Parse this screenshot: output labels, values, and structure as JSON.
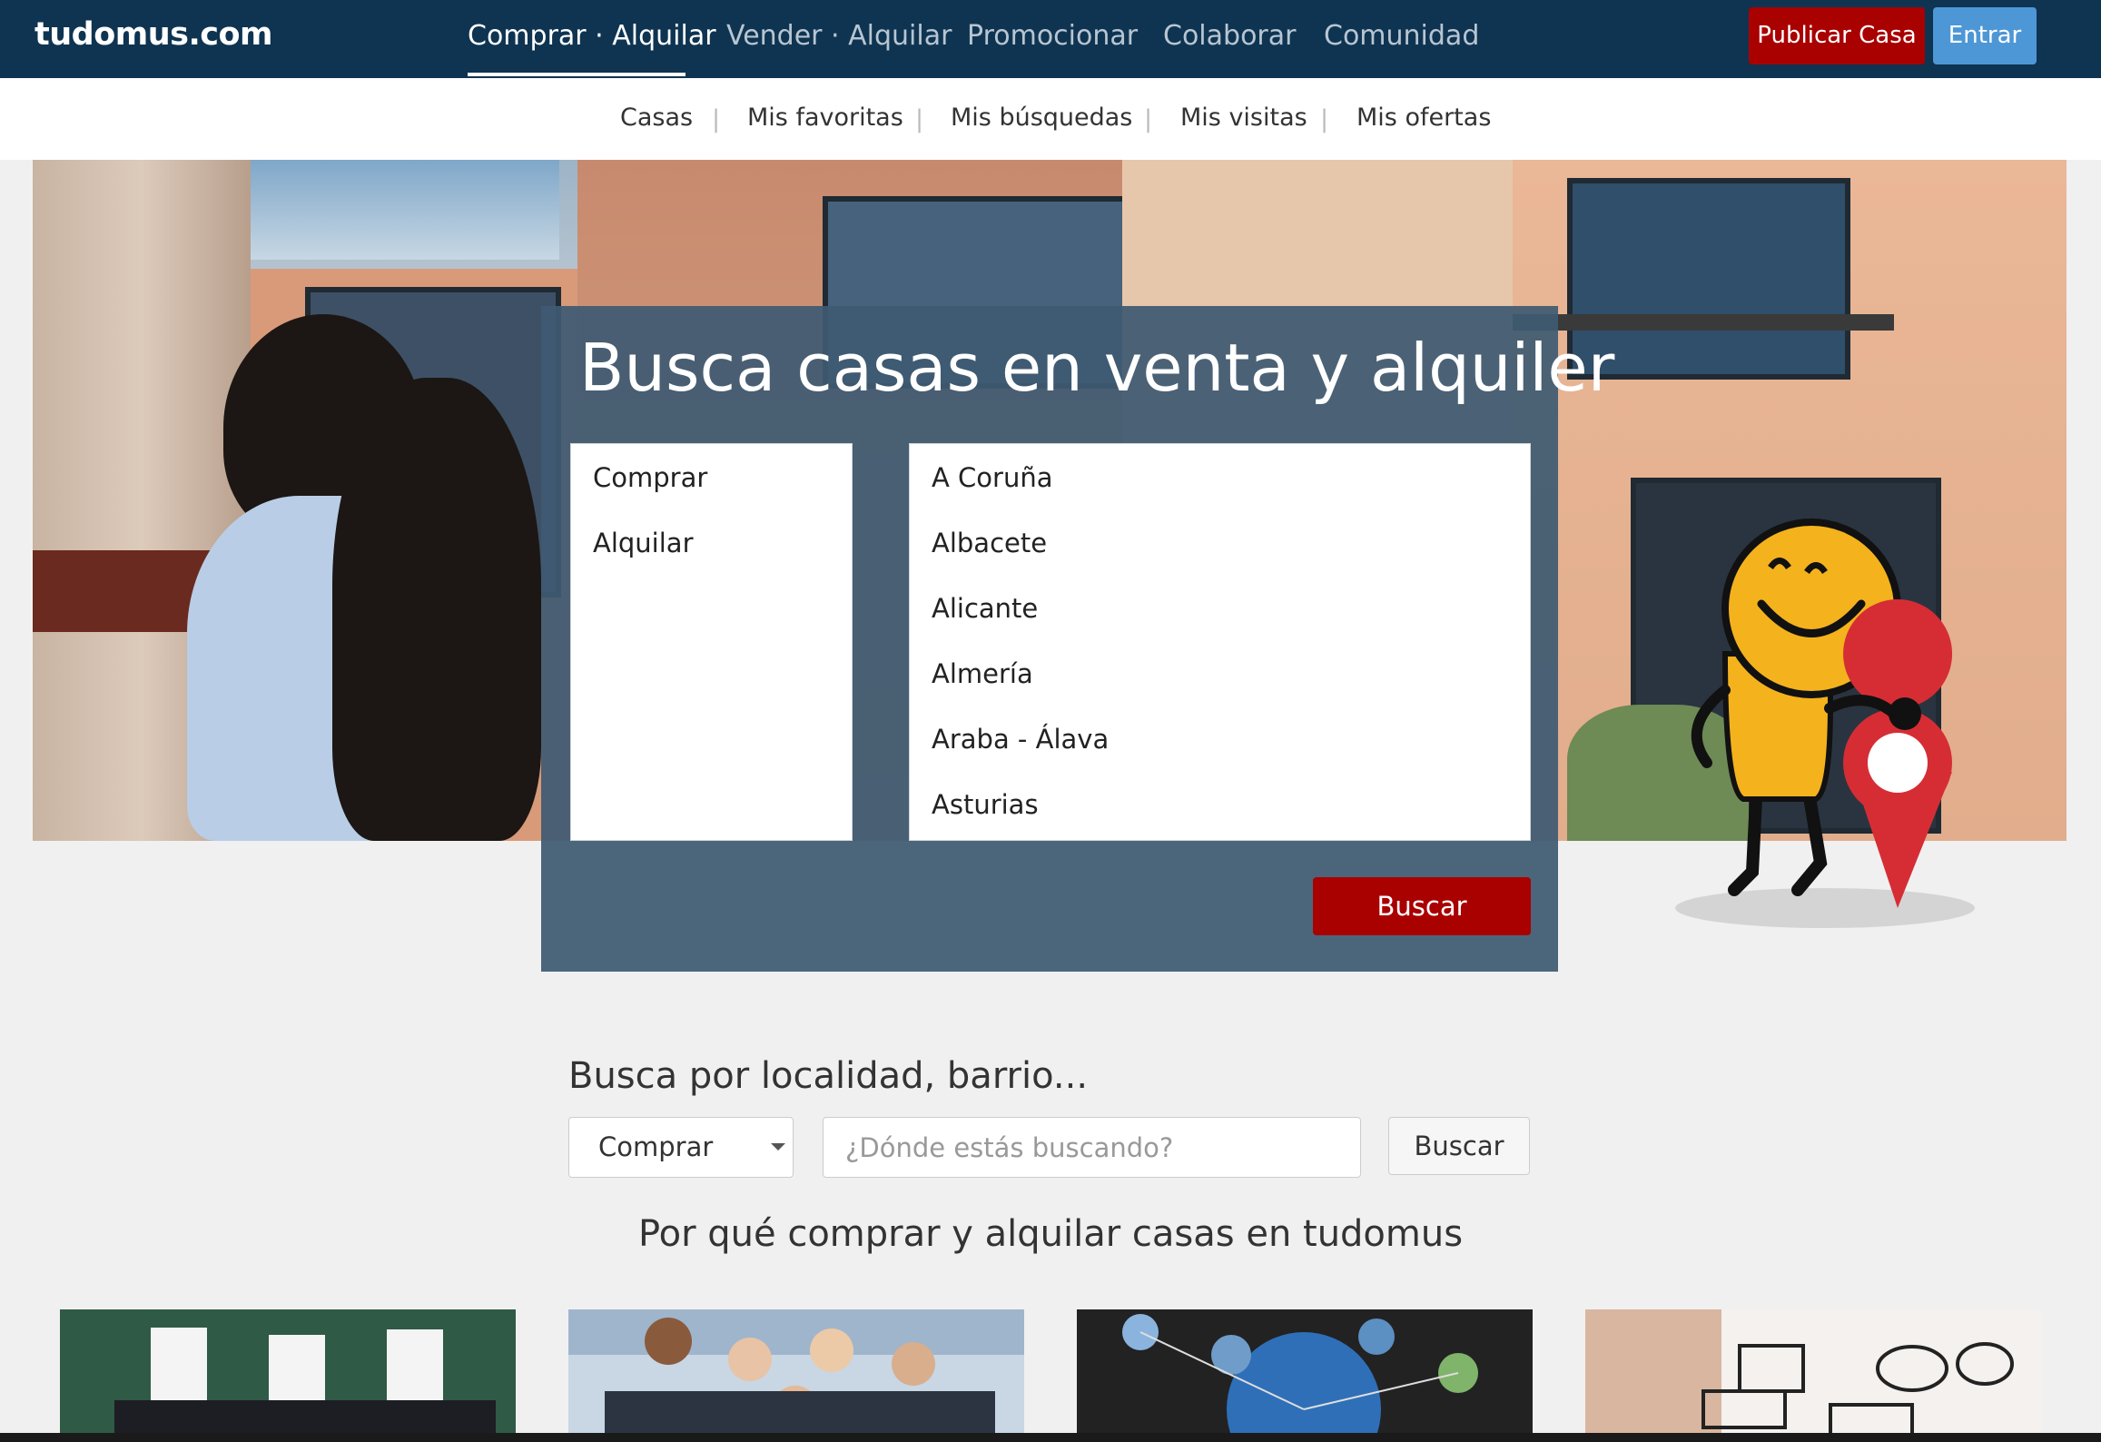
{
  "brand": {
    "logo_text": "tudomus.com"
  },
  "nav": {
    "items": [
      "Comprar · Alquilar",
      "Vender · Alquilar",
      "Promocionar",
      "Colaborar",
      "Comunidad"
    ],
    "active_index": 0
  },
  "header_buttons": {
    "publicar": "Publicar Casa",
    "entrar": "Entrar"
  },
  "subnav": {
    "items": [
      "Casas",
      "Mis favoritas",
      "Mis búsquedas",
      "Mis visitas",
      "Mis ofertas"
    ],
    "separator": "|"
  },
  "hero_search": {
    "title": "Busca casas en venta y alquiler",
    "operations": [
      "Comprar",
      "Alquilar"
    ],
    "provinces": [
      "A Coruña",
      "Albacete",
      "Alicante",
      "Almería",
      "Araba - Álava",
      "Asturias"
    ],
    "button": "Buscar"
  },
  "locality_search": {
    "title": "Busca por localidad, barrio...",
    "select_value": "Comprar",
    "input_placeholder": "¿Dónde estás buscando?",
    "button": "Buscar"
  },
  "why": {
    "title": "Por qué comprar y alquilar casas en tudomus"
  },
  "colors": {
    "navbar": "#0e3451",
    "primary_red": "#a90000",
    "button_blue": "#4d97d6",
    "panel": "#3e5a72",
    "page_bg": "#f0f0f0"
  }
}
